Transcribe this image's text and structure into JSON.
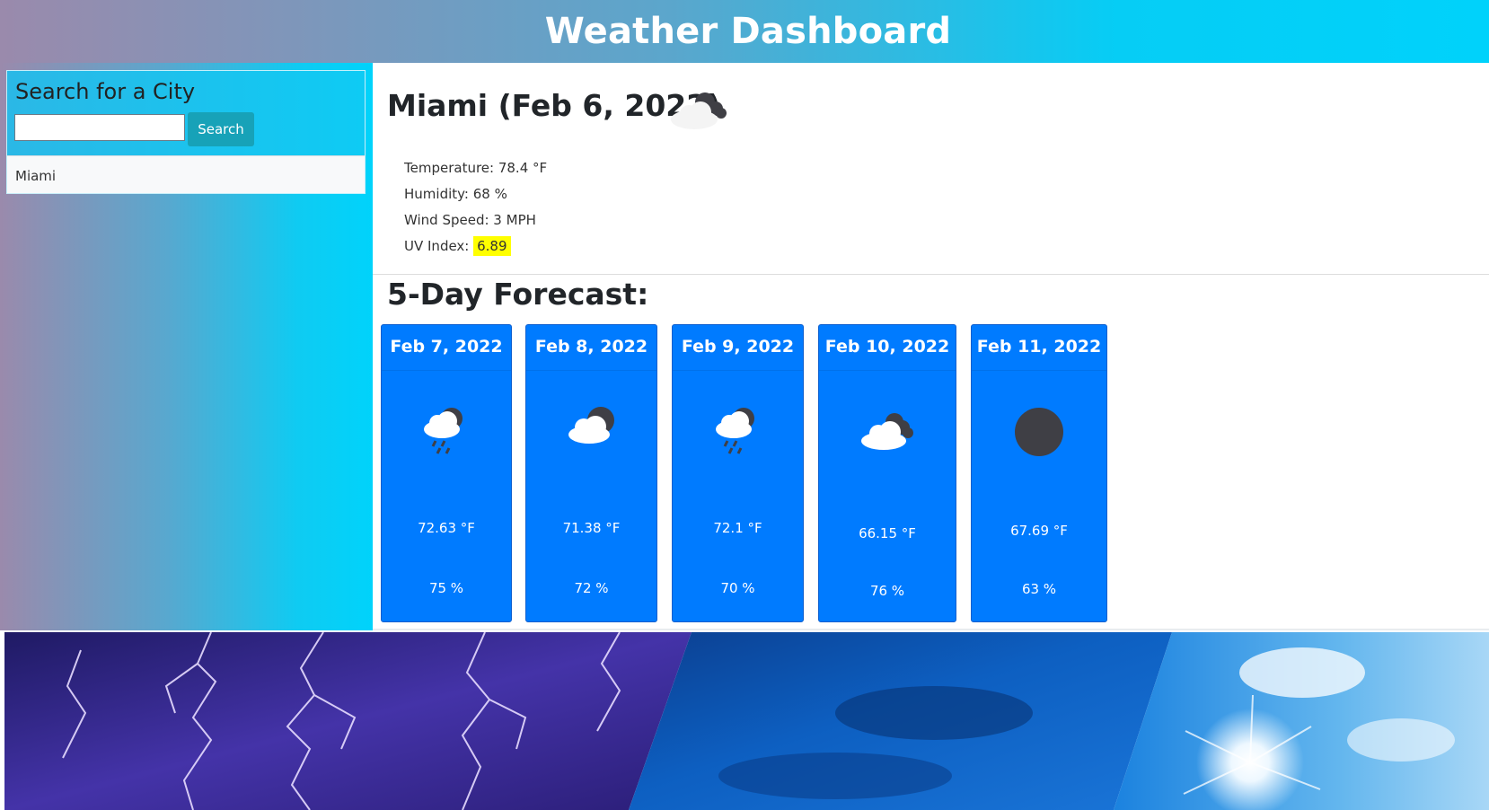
{
  "header": {
    "title": "Weather Dashboard"
  },
  "sidebar": {
    "search_title": "Search for a City",
    "search_input_value": "",
    "search_button": "Search",
    "history": [
      "Miami"
    ]
  },
  "current": {
    "title": "Miami (Feb 6, 2022)",
    "icon": "cloudy-icon",
    "temperature": "Temperature: 78.4 °F",
    "humidity": "Humidity: 68 %",
    "wind": "Wind Speed: 3 MPH",
    "uv_label": "UV Index: ",
    "uv_value": "6.89"
  },
  "forecast": {
    "title": "5-Day Forecast:",
    "days": [
      {
        "date": "Feb 7, 2022",
        "icon": "rain-icon",
        "temp": "72.63 °F",
        "humidity": "75 %"
      },
      {
        "date": "Feb 8, 2022",
        "icon": "partly-cloudy-icon",
        "temp": "71.38 °F",
        "humidity": "72 %"
      },
      {
        "date": "Feb 9, 2022",
        "icon": "rain-icon",
        "temp": "72.1 °F",
        "humidity": "70 %"
      },
      {
        "date": "Feb 10, 2022",
        "icon": "cloudy-icon",
        "temp": "66.15 °F",
        "humidity": "76 %"
      },
      {
        "date": "Feb 11, 2022",
        "icon": "clear-night-icon",
        "temp": "67.69 °F",
        "humidity": "63 %"
      }
    ]
  },
  "colors": {
    "card_blue": "#007bff",
    "button_teal": "#17a2b8",
    "uv_highlight": "#ffff00"
  }
}
